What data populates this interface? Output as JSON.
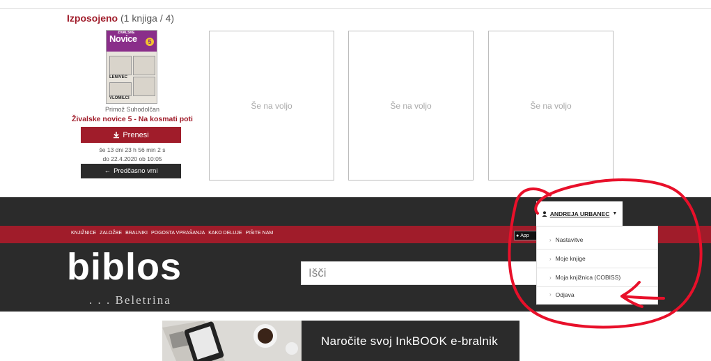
{
  "borrowed": {
    "title": "Izposojeno",
    "count": "(1 knjiga / 4)",
    "book": {
      "cover_logo": "Novice",
      "cover_badge": "5",
      "cover_labels": [
        "ŽIVALSKE",
        "LENIVEC",
        "VLOMILCI"
      ],
      "author": "Primož Suhodolčan",
      "title": "Živalske novice 5 - Na kosmati poti",
      "download_label": "Prenesi",
      "time_left": "še 13 dni 23 h 56 min 2 s",
      "due_date": "do 22.4.2020 ob 10:05",
      "return_label": "Predčasno vrni"
    },
    "empty_slots": [
      "Še na voljo",
      "Še na voljo",
      "Še na voljo"
    ]
  },
  "nav": {
    "links": [
      "KNJIŽNICE",
      "ZALOŽBE",
      "BRALNIKI",
      "POGOSTA VPRAŠANJA",
      "KAKO DELUJE",
      "PIŠITE NAM"
    ],
    "appstore_label": "App"
  },
  "brand": {
    "name": "biblos",
    "subtitle": ". . . Beletrina"
  },
  "search": {
    "placeholder": "Išči"
  },
  "user_menu": {
    "name": "ANDREJA URBANEC",
    "items": [
      {
        "label": "Nastavitve"
      },
      {
        "label": "Moje knjige"
      },
      {
        "label": "Moja knjižnica (COBISS)"
      },
      {
        "label": "Odjava"
      }
    ]
  },
  "banner": {
    "text": "Naročite svoj InkBOOK e-bralnik"
  },
  "colors": {
    "brand_red": "#a01c2a",
    "dark": "#2b2b2b",
    "annotation_red": "#e8102a"
  }
}
